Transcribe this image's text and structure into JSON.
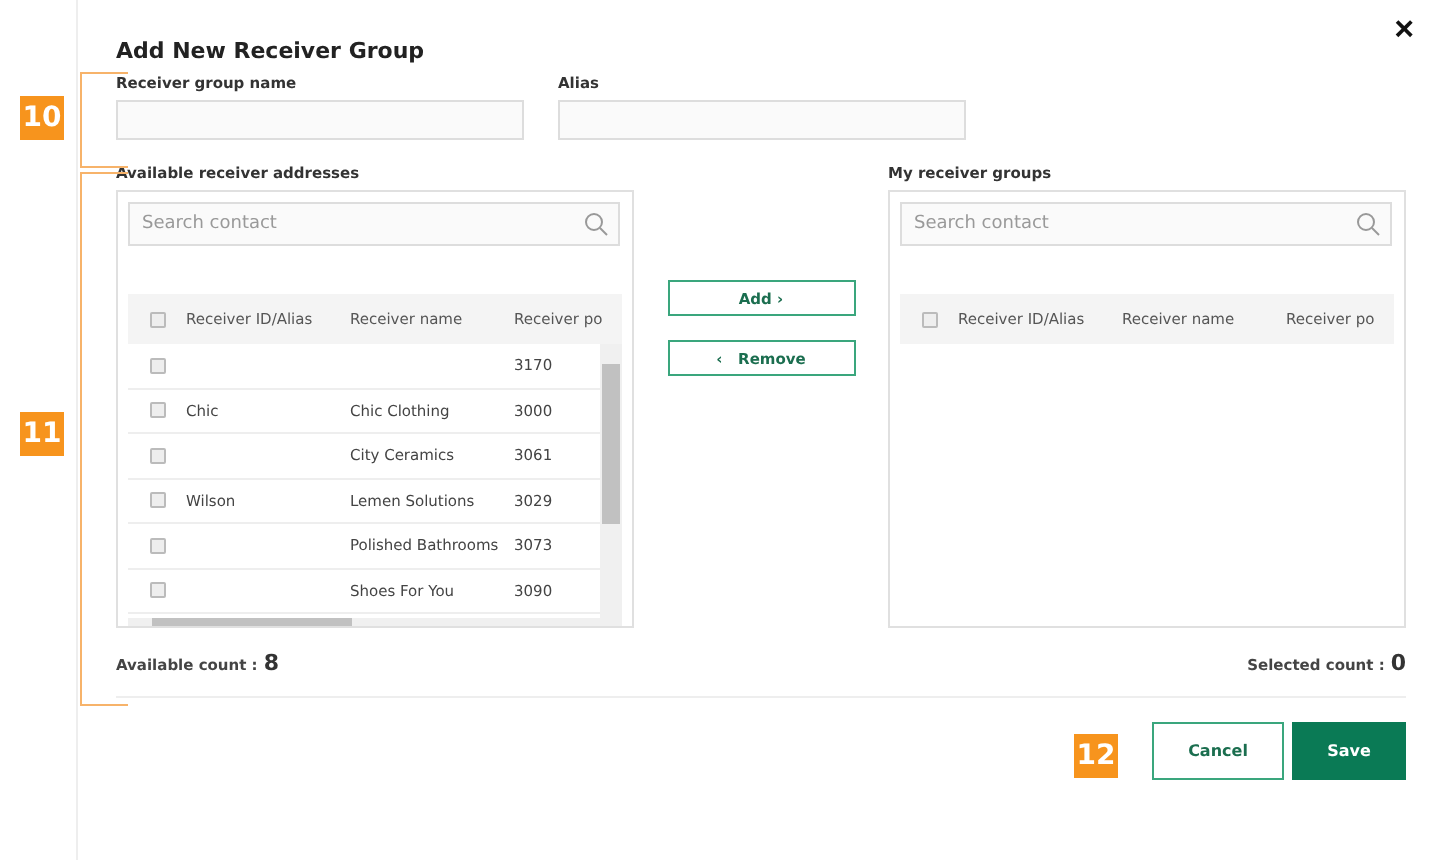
{
  "dialog": {
    "title": "Add New Receiver Group",
    "close": "×"
  },
  "fields": [
    {
      "label": "Receiver group name"
    },
    {
      "label": "Alias"
    }
  ],
  "available": {
    "title": "Available receiver addresses",
    "search": {
      "placeholder": "Search contact"
    },
    "columns": [
      "Receiver ID/Alias",
      "Receiver name",
      "Receiver po"
    ],
    "header_checked": false,
    "rows": [
      {
        "checked": false,
        "cells": [
          "",
          "",
          "3170"
        ]
      },
      {
        "checked": false,
        "cells": [
          "Chic",
          "Chic Clothing",
          "3000"
        ]
      },
      {
        "checked": false,
        "cells": [
          "",
          "City Ceramics",
          "3061"
        ]
      },
      {
        "checked": false,
        "cells": [
          "Wilson",
          "Lemen Solutions",
          "3029"
        ]
      },
      {
        "checked": false,
        "cells": [
          "",
          "Polished Bathrooms",
          "3073"
        ]
      },
      {
        "checked": false,
        "cells": [
          "",
          "Shoes For You",
          "3090"
        ]
      }
    ],
    "count_label": "Available count :",
    "count": "8"
  },
  "transfer": {
    "add": "Add",
    "add_icon": "›",
    "remove": "Remove",
    "remove_icon": "‹"
  },
  "selected": {
    "title": "My receiver groups",
    "search": {
      "placeholder": "Search contact"
    },
    "columns": [
      "Receiver ID/Alias",
      "Receiver name",
      "Receiver po"
    ],
    "header_checked": false,
    "count_label": "Selected count :",
    "count": "0"
  },
  "footer": {
    "cancel": "Cancel",
    "save": "Save"
  },
  "callouts": [
    "10",
    "11",
    "12"
  ]
}
